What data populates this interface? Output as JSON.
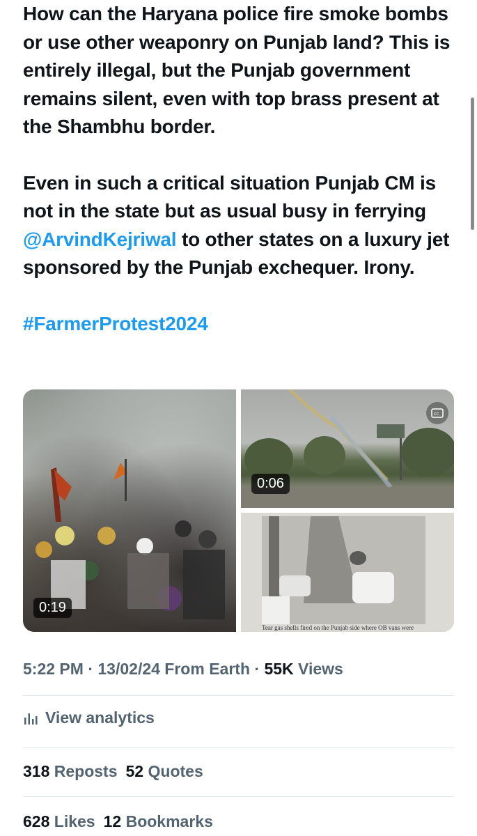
{
  "tweet": {
    "para1": "How can the Haryana police fire smoke bombs or use other weaponry on Punjab land? This is entirely illegal, but the Punjab government remains silent, even with top brass present at the Shambhu border.",
    "para2_before": "Even in such a critical situation Punjab CM is not in the state but as usual busy in ferrying ",
    "mention": "@ArvindKejriwal",
    "para2_after": " to other states on a luxury jet sponsored by the Punjab exchequer. Irony.",
    "hashtag": "#FarmerProtest2024"
  },
  "media": [
    {
      "duration": "0:19",
      "kind": "video"
    },
    {
      "duration": "0:06",
      "kind": "video"
    },
    {
      "caption": "Tear gas shells fired on the Punjab side where OB vans were",
      "kind": "image"
    }
  ],
  "meta": {
    "time": "5:22 PM",
    "sep": " · ",
    "date": "13/02/24",
    "source": " From Earth",
    "views_count": "55K",
    "views_label": " Views"
  },
  "analytics": {
    "label": "View analytics",
    "icon": "analytics-icon"
  },
  "stats": {
    "reposts_count": "318",
    "reposts_label": "Reposts",
    "quotes_count": "52",
    "quotes_label": "Quotes",
    "likes_count": "628",
    "likes_label": "Likes",
    "bookmarks_count": "12",
    "bookmarks_label": "Bookmarks"
  },
  "colors": {
    "link": "#1d9bf0",
    "secondary": "#536471",
    "primary": "#0f1419"
  }
}
